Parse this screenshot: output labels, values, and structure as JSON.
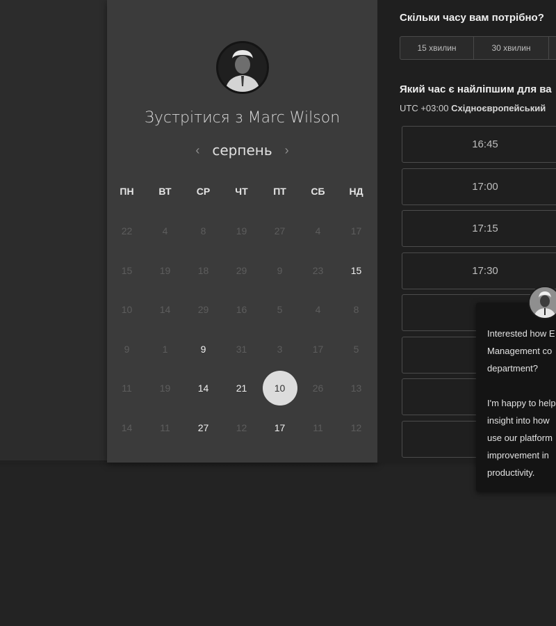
{
  "colors": {
    "page_bg": "#232323",
    "calendar_panel_bg": "#3b3b3b",
    "time_panel_bg": "#1f1f1f",
    "selected_day_bg": "#dcdcdc"
  },
  "host": {
    "avatar_icon": "person-avatar-icon",
    "title_prefix": "Зустрітися з ",
    "name": "Marc Wilson"
  },
  "calendar": {
    "month": "серпень",
    "prev_icon": "chevron-left-icon",
    "next_icon": "chevron-right-icon",
    "weekdays": [
      "ПН",
      "ВТ",
      "СР",
      "ЧТ",
      "ПТ",
      "СБ",
      "НД"
    ],
    "weeks": [
      [
        {
          "d": "22",
          "a": false
        },
        {
          "d": "4",
          "a": false
        },
        {
          "d": "8",
          "a": false
        },
        {
          "d": "19",
          "a": false
        },
        {
          "d": "27",
          "a": false
        },
        {
          "d": "4",
          "a": false
        },
        {
          "d": "17",
          "a": false
        }
      ],
      [
        {
          "d": "15",
          "a": false
        },
        {
          "d": "19",
          "a": false
        },
        {
          "d": "18",
          "a": false
        },
        {
          "d": "29",
          "a": false
        },
        {
          "d": "9",
          "a": false
        },
        {
          "d": "23",
          "a": false
        },
        {
          "d": "15",
          "a": true
        }
      ],
      [
        {
          "d": "10",
          "a": false
        },
        {
          "d": "14",
          "a": false
        },
        {
          "d": "29",
          "a": false
        },
        {
          "d": "16",
          "a": false
        },
        {
          "d": "5",
          "a": false
        },
        {
          "d": "4",
          "a": false
        },
        {
          "d": "8",
          "a": false
        }
      ],
      [
        {
          "d": "9",
          "a": false
        },
        {
          "d": "1",
          "a": false
        },
        {
          "d": "9",
          "a": true
        },
        {
          "d": "31",
          "a": false
        },
        {
          "d": "3",
          "a": false
        },
        {
          "d": "17",
          "a": false
        },
        {
          "d": "5",
          "a": false
        }
      ],
      [
        {
          "d": "11",
          "a": false
        },
        {
          "d": "19",
          "a": false
        },
        {
          "d": "14",
          "a": true
        },
        {
          "d": "21",
          "a": true
        },
        {
          "d": "10",
          "a": true,
          "selected": true
        },
        {
          "d": "26",
          "a": false
        },
        {
          "d": "13",
          "a": false
        }
      ],
      [
        {
          "d": "14",
          "a": false
        },
        {
          "d": "11",
          "a": false
        },
        {
          "d": "27",
          "a": true
        },
        {
          "d": "12",
          "a": false
        },
        {
          "d": "17",
          "a": true
        },
        {
          "d": "11",
          "a": false
        },
        {
          "d": "12",
          "a": false
        }
      ]
    ]
  },
  "duration": {
    "question": "Скільки часу вам потрібно?",
    "options": [
      "15 хвилин",
      "30 хвилин",
      ""
    ]
  },
  "time_select": {
    "question": "Який час є найліпшим для ва",
    "tz_offset": "UTC +03:00",
    "tz_name": "Східноєвропейський",
    "slots": [
      "16:45",
      "17:00",
      "17:15",
      "17:30",
      "",
      "",
      "",
      ""
    ]
  },
  "chat": {
    "avatar_icon": "person-avatar-icon",
    "lines": [
      "Interested how E",
      "Management co",
      "department?",
      "",
      "I'm happy to help",
      "insight into how",
      "use our platform",
      "improvement in",
      "productivity."
    ]
  }
}
